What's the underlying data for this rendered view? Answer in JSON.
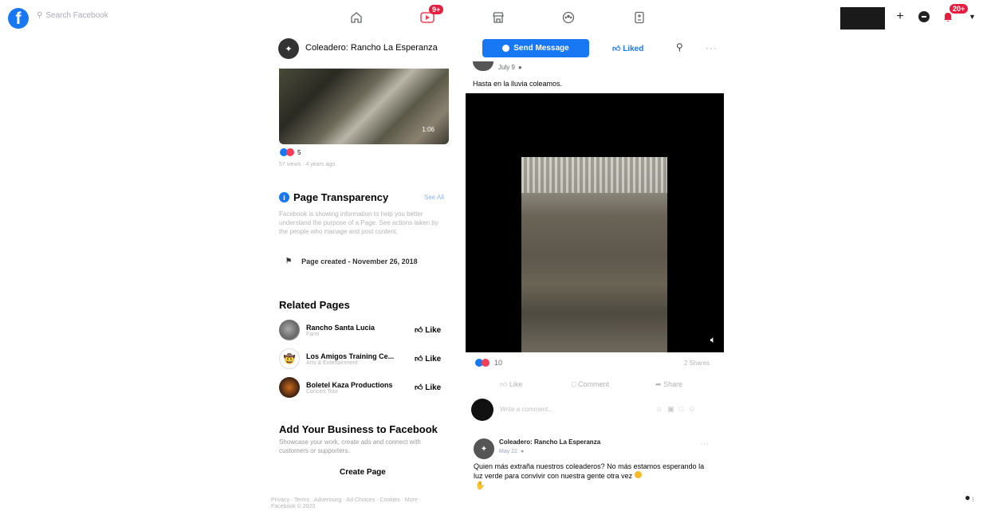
{
  "nav": {
    "search_placeholder": "Search Facebook",
    "video_badge": "9+",
    "notifications_badge": "20+"
  },
  "page_header": {
    "name": "Coleadero: Rancho La Esperanza",
    "send_message": "Send Message",
    "liked": "Liked"
  },
  "left": {
    "video_duration": "1:06",
    "video_reaction_count": "5",
    "video_meta": "57 views · 4 years ago",
    "transparency": {
      "title": "Page Transparency",
      "see_all": "See All",
      "description": "Facebook is showing information to help you better understand the purpose of a Page. See actions taken by the people who manage and post content.",
      "page_created": "Page created - November 26, 2018"
    },
    "related_title": "Related Pages",
    "related": [
      {
        "name": "Rancho Santa Lucia",
        "sub": "Farm",
        "like": "Like"
      },
      {
        "name": "Los Amigos Training Ce...",
        "sub": "Arts & Entertainment",
        "like": "Like"
      },
      {
        "name": "Boletel Kaza Productions",
        "sub": "Concert Tour",
        "like": "Like"
      }
    ],
    "add_business": {
      "title": "Add Your Business to Facebook",
      "text": "Showcase your work, create ads and connect with customers or supporters.",
      "button": "Create Page"
    },
    "footer": "Privacy · Terms · Advertising · Ad Choices · Cookies · More · Facebook © 2020"
  },
  "post1": {
    "date": "July 9",
    "text": "Hasta en la lluvia coleamos.",
    "reaction_count": "10",
    "shares": "2 Shares",
    "like": "Like",
    "comment": "Comment",
    "share": "Share",
    "comment_placeholder": "Write a comment..."
  },
  "post2": {
    "author": "Coleadero: Rancho La Esperanza",
    "date": "May 22",
    "text": "Quien más extraña nuestros coleaderos? No más estamos esperando la luz verde para convivir con nuestra gente otra vez"
  },
  "colors": {
    "brand": "#1877f2",
    "badge": "#e41e3f"
  }
}
